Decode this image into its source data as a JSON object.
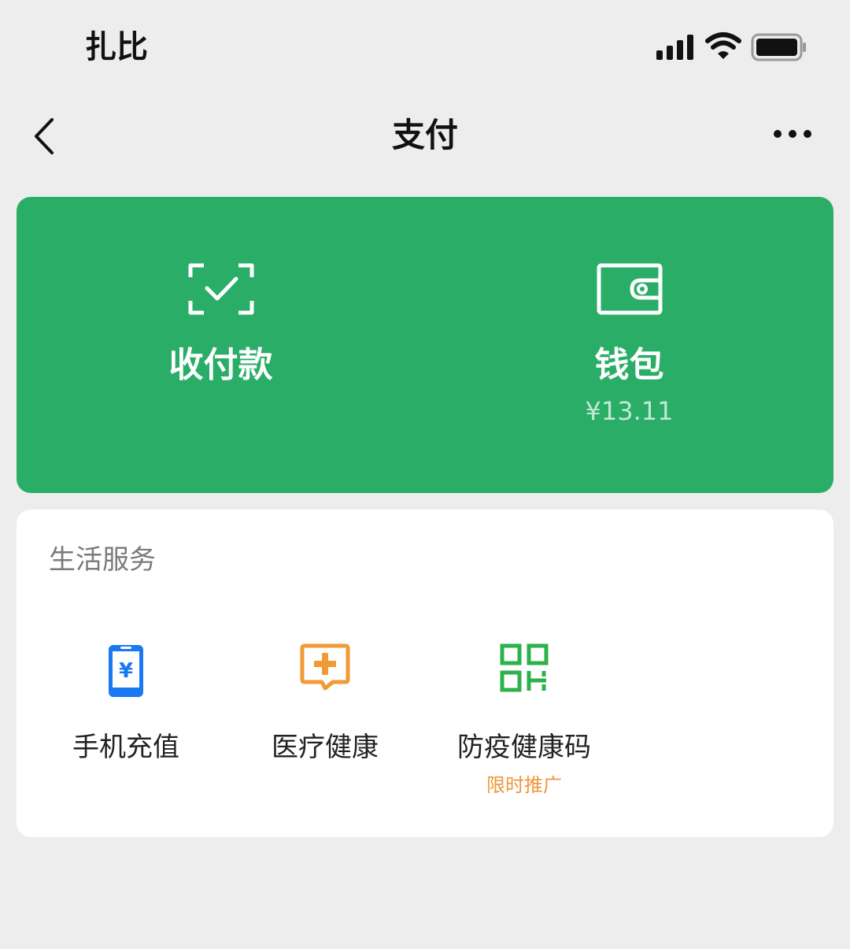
{
  "status_bar": {
    "carrier": "扎比",
    "icons": [
      "signal-icon",
      "wifi-icon",
      "battery-icon"
    ]
  },
  "nav": {
    "title": "支付",
    "back_icon": "back-arrow-icon",
    "more_icon": "more-icon"
  },
  "pay_card": {
    "color": "#2aad67",
    "items": [
      {
        "label": "收付款",
        "icon": "scan-check-icon"
      },
      {
        "label": "钱包",
        "balance": "¥13.11",
        "icon": "wallet-icon"
      }
    ]
  },
  "life_services": {
    "title": "生活服务",
    "items": [
      {
        "label": "手机充值",
        "icon": "phone-recharge-icon",
        "color": "#1a78f2"
      },
      {
        "label": "医疗健康",
        "icon": "medical-health-icon",
        "color": "#f29a36"
      },
      {
        "label": "防疫健康码",
        "sub": "限时推广",
        "icon": "health-code-icon",
        "color": "#2bb24c"
      }
    ]
  }
}
